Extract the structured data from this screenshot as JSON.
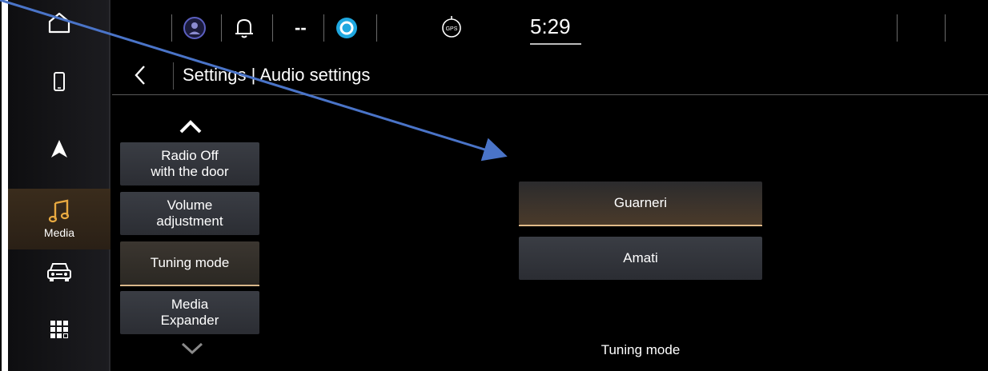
{
  "sidebar": {
    "items": [
      {
        "icon": "home-icon"
      },
      {
        "icon": "phone-icon"
      },
      {
        "icon": "navigation-icon"
      },
      {
        "icon": "music-note-icon",
        "label": "Media"
      },
      {
        "icon": "car-icon"
      },
      {
        "icon": "apps-grid-icon"
      }
    ]
  },
  "topbar": {
    "dashes": "--",
    "clock": "5:29",
    "gps_label": "GPS"
  },
  "header": {
    "title": "Settings |  Audio settings"
  },
  "menu": {
    "items": [
      {
        "line1": "Radio Off",
        "line2": "with the door"
      },
      {
        "line1": "Volume",
        "line2": "adjustment"
      },
      {
        "line1": "Tuning mode",
        "line2": "",
        "selected": true
      },
      {
        "line1": "Media",
        "line2": "Expander"
      }
    ]
  },
  "options": {
    "items": [
      {
        "label": "Guarneri",
        "selected": true
      },
      {
        "label": "Amati"
      }
    ],
    "caption": "Tuning mode"
  },
  "colors": {
    "accent": "#d9b78a",
    "annotation_arrow": "#4a74c8",
    "alexa_blue": "#1fa8e0"
  }
}
